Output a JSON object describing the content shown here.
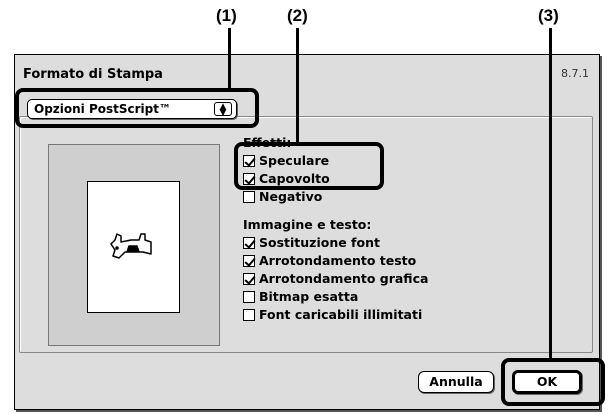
{
  "callouts": [
    "(1)",
    "(2)",
    "(3)"
  ],
  "dialog": {
    "title": "Formato di Stampa",
    "version": "8.7.1",
    "popup_value": "Opzioni PostScript™",
    "popup_icon": "up-down-arrows-icon"
  },
  "effects": {
    "header": "Effetti:",
    "items": [
      {
        "label": "Speculare",
        "checked": true
      },
      {
        "label": "Capovolto",
        "checked": true
      },
      {
        "label": "Negativo",
        "checked": false
      }
    ]
  },
  "image_text": {
    "header": "Immagine e testo:",
    "items": [
      {
        "label": "Sostituzione font",
        "checked": true
      },
      {
        "label": "Arrotondamento testo",
        "checked": true
      },
      {
        "label": "Arrotondamento grafica",
        "checked": true
      },
      {
        "label": "Bitmap esatta",
        "checked": false
      },
      {
        "label": "Font caricabili illimitati",
        "checked": false
      }
    ]
  },
  "buttons": {
    "cancel": "Annulla",
    "ok": "OK"
  }
}
